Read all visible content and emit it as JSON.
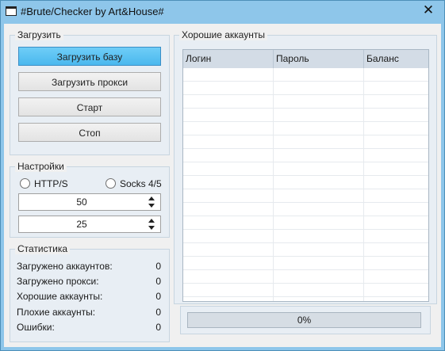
{
  "window": {
    "title": "#Brute/Checker by Art&House#",
    "close_glyph": "✕"
  },
  "load_group": {
    "legend": "Загрузить",
    "buttons": [
      {
        "label": "Загрузить базу"
      },
      {
        "label": "Загрузить прокси"
      },
      {
        "label": "Старт"
      },
      {
        "label": "Стоп"
      }
    ]
  },
  "settings_group": {
    "legend": "Настройки",
    "radio_http": "HTTP/S",
    "radio_socks": "Socks 4/5",
    "threads_value": "50",
    "timeout_value": "25"
  },
  "stats_group": {
    "legend": "Статистика",
    "rows": [
      {
        "label": "Загружено аккаунтов:",
        "value": "0"
      },
      {
        "label": "Загружено прокси:",
        "value": "0"
      },
      {
        "label": "Хорошие аккаунты:",
        "value": "0"
      },
      {
        "label": "Плохие аккаунты:",
        "value": "0"
      },
      {
        "label": "Ошибки:",
        "value": "0"
      }
    ]
  },
  "accounts_group": {
    "legend": "Хорошие аккаунты",
    "columns": [
      "Логин",
      "Пароль",
      "Баланс"
    ]
  },
  "progress": {
    "text": "0%",
    "value": 0
  },
  "colors": {
    "titlebar": "#8ec6ea",
    "primary_button": "#4ab8ee"
  }
}
